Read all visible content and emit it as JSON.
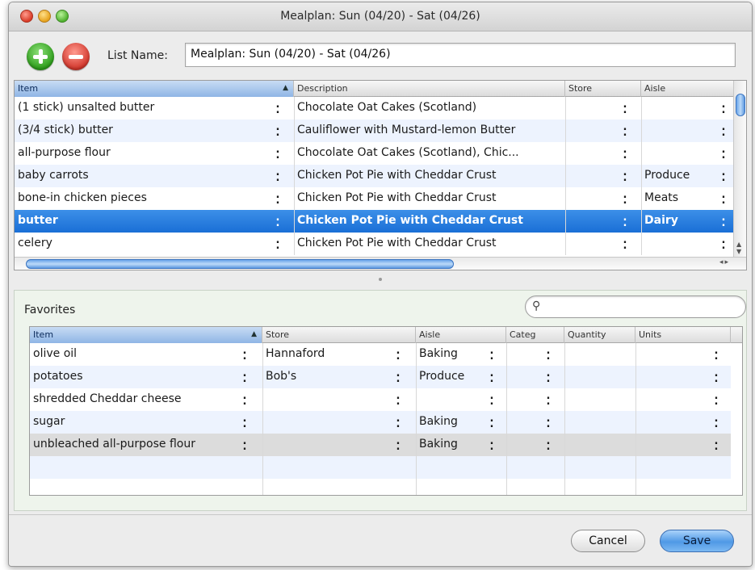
{
  "window": {
    "title": "Mealplan: Sun (04/20) - Sat (04/26)"
  },
  "toolbar": {
    "add_icon": "plus-circle-icon",
    "remove_icon": "minus-circle-icon",
    "list_name_label": "List Name:",
    "list_name_value": "Mealplan: Sun (04/20) - Sat (04/26)"
  },
  "main_table": {
    "columns": [
      "Item",
      "Description",
      "Store",
      "Aisle"
    ],
    "sorted_column": "Item",
    "rows": [
      {
        "item": "(1 stick) unsalted butter",
        "description": "Chocolate Oat Cakes (Scotland)",
        "store": "",
        "aisle": ""
      },
      {
        "item": "(3/4 stick) butter",
        "description": "Cauliflower with Mustard-lemon Butter",
        "store": "",
        "aisle": ""
      },
      {
        "item": "all-purpose flour",
        "description": "Chocolate Oat Cakes (Scotland), Chic...",
        "store": "",
        "aisle": ""
      },
      {
        "item": "baby carrots",
        "description": "Chicken Pot Pie with Cheddar Crust",
        "store": "",
        "aisle": "Produce"
      },
      {
        "item": "bone-in chicken pieces",
        "description": "Chicken Pot Pie with Cheddar Crust",
        "store": "",
        "aisle": "Meats"
      },
      {
        "item": "butter",
        "description": "Chicken Pot Pie with Cheddar Crust",
        "store": "",
        "aisle": "Dairy"
      },
      {
        "item": "celery",
        "description": "Chicken Pot Pie with Cheddar Crust",
        "store": "",
        "aisle": ""
      }
    ],
    "selected_row": 5
  },
  "favorites": {
    "label": "Favorites",
    "search_placeholder": "",
    "search_icon": "magnifier-icon",
    "columns": [
      "Item",
      "Store",
      "Aisle",
      "Categ",
      "Quantity",
      "Units"
    ],
    "rows": [
      {
        "item": "olive oil",
        "store": "Hannaford",
        "aisle": "Baking",
        "categ": "",
        "quantity": "",
        "units": ""
      },
      {
        "item": "potatoes",
        "store": "Bob's",
        "aisle": "Produce",
        "categ": "",
        "quantity": "",
        "units": ""
      },
      {
        "item": "shredded Cheddar cheese",
        "store": "",
        "aisle": "",
        "categ": "",
        "quantity": "",
        "units": ""
      },
      {
        "item": "sugar",
        "store": "",
        "aisle": "Baking",
        "categ": "",
        "quantity": "",
        "units": ""
      },
      {
        "item": "unbleached all-purpose flour",
        "store": "",
        "aisle": "Baking",
        "categ": "",
        "quantity": "",
        "units": ""
      }
    ]
  },
  "buttons": {
    "cancel": "Cancel",
    "save": "Save"
  }
}
